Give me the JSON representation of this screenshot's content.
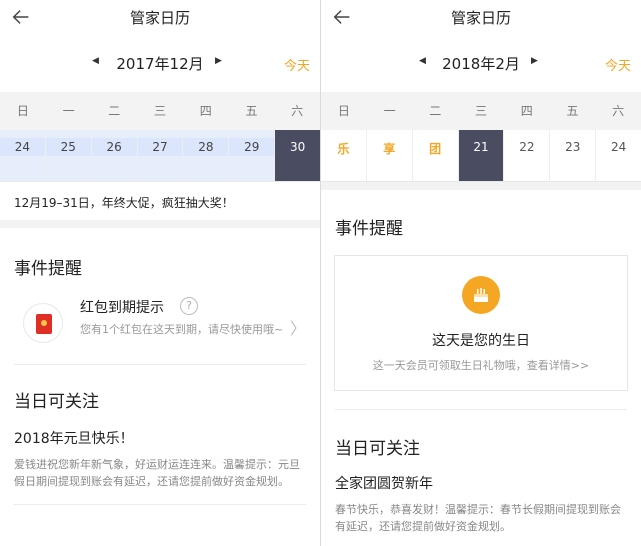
{
  "left": {
    "title": "管家日历",
    "month": "2017年12月",
    "today": "今天",
    "weekdays": [
      "日",
      "一",
      "二",
      "三",
      "四",
      "五",
      "六"
    ],
    "days": [
      "24",
      "25",
      "26",
      "27",
      "28",
      "29",
      "30"
    ],
    "promo": "12月19–31日，年终大促，疯狂抽大奖！",
    "events_title": "事件提醒",
    "event": {
      "title": "红包到期提示",
      "help": "?",
      "desc": "您有1个红包在这天到期，请尽快使用哦~"
    },
    "focus_title": "当日可关注",
    "focus_head": "2018年元旦快乐！",
    "focus_desc": "爱钱进祝您新年新气象，好运财运连连来。温馨提示：元旦假日期间提现到账会有延迟，还请您提前做好资金规划。"
  },
  "right": {
    "title": "管家日历",
    "month": "2018年2月",
    "today": "今天",
    "weekdays": [
      "日",
      "一",
      "二",
      "三",
      "四",
      "五",
      "六"
    ],
    "days": [
      "乐",
      "享",
      "团",
      "21",
      "22",
      "23",
      "24"
    ],
    "events_title": "事件提醒",
    "birthday_title": "这天是您的生日",
    "birthday_link": "这一天会员可领取生日礼物哦，查看详情>>",
    "focus_title": "当日可关注",
    "focus_head": "全家团圆贺新年",
    "focus_desc": "春节快乐，恭喜发财！温馨提示：春节长假期间提现到账会有延迟，还请您提前做好资金规划。"
  },
  "colors": {
    "accent": "#f5a623",
    "selected": "#4a4d62",
    "highlight": "#e6eefc",
    "danger": "#e02e24"
  }
}
